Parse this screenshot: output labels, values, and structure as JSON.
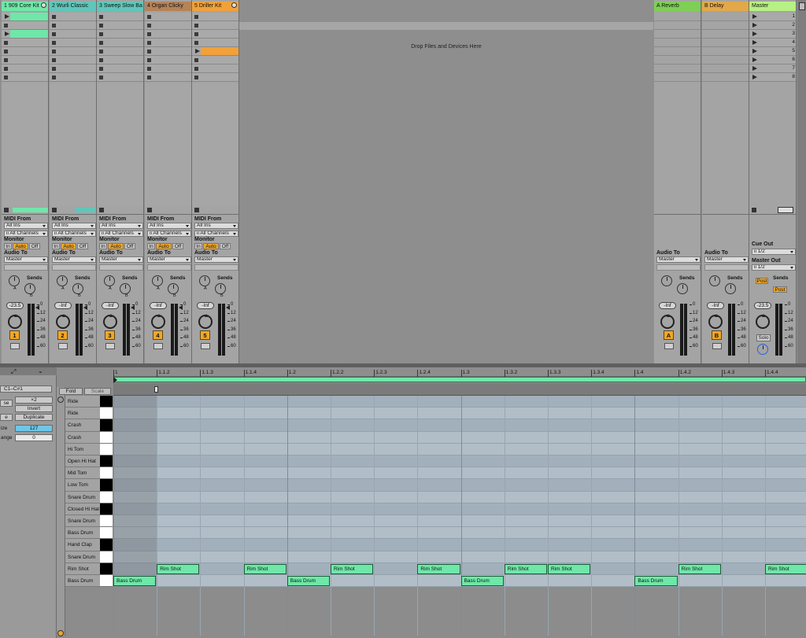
{
  "tracks": [
    {
      "name": "1 909 Core Kit",
      "color": "#6fe7a8",
      "number": "1",
      "volume": "-23.5"
    },
    {
      "name": "2 Wurli Classic",
      "color": "#5fc7ba",
      "number": "2",
      "volume": "-Inf"
    },
    {
      "name": "3 Sweep Slow Ba",
      "color": "#5fc7ba",
      "number": "3",
      "volume": "-Inf"
    },
    {
      "name": "4 Organ Clicky",
      "color": "#b58358",
      "number": "4",
      "volume": "-Inf"
    },
    {
      "name": "5 Driller Kit",
      "color": "#f0a13a",
      "number": "5",
      "volume": "-Inf"
    }
  ],
  "returns": [
    {
      "name": "A Reverb",
      "color": "#7ecf54",
      "letter": "A",
      "volume": "-Inf"
    },
    {
      "name": "B Delay",
      "color": "#e2a84a",
      "letter": "B",
      "volume": "-Inf"
    }
  ],
  "master": {
    "name": "Master",
    "color": "#b7f084",
    "volume": "-23.5",
    "scenes": [
      "1",
      "2",
      "3",
      "4",
      "5",
      "6",
      "7",
      "8"
    ],
    "cue_out_label": "Cue Out",
    "cue_out": "ii 1/2",
    "master_out_label": "Master Out",
    "master_out": "ii 1/2",
    "post1": "Post",
    "post2": "Post",
    "solo": "Solo"
  },
  "drop_hint": "Drop Files and Devices Here",
  "io": {
    "midi_from": "MIDI From",
    "all_ins": "All Ins",
    "all_channels": "ii All Channels",
    "monitor": "Monitor",
    "in": "In",
    "auto": "Auto",
    "off": "Off",
    "audio_to": "Audio To",
    "master": "Master",
    "sends": "Sends",
    "send_a": "A",
    "send_b": "B"
  },
  "meter_ticks": [
    "0",
    "12",
    "24",
    "36",
    "48",
    "60"
  ],
  "clip_editor": {
    "range": "C1–C#1",
    "x2": "×2",
    "invert_prefix": "se",
    "invert": "Invert",
    "duplicate_prefix": "e",
    "duplicate": "Duplicate",
    "size_label": "ize",
    "size_value": "127",
    "range_label": "ange",
    "range_value": "0",
    "fold": "Fold",
    "scale": "Scale",
    "ruler": [
      "1",
      "1.1.2",
      "1.1.3",
      "1.1.4",
      "1.2",
      "1.2.2",
      "1.2.3",
      "1.2.4",
      "1.3",
      "1.3.2",
      "1.3.3",
      "1.3.4",
      "1.4",
      "1.4.2",
      "1.4.3",
      "1.4.4"
    ],
    "rows": [
      "Ride",
      "Ride",
      "Crash",
      "Crash",
      "Hi Tom",
      "Open Hi Hat",
      "Mid Tom",
      "Low Tom",
      "Snare Drum",
      "Closed Hi Hat",
      "Snare Drum",
      "Bass Drum",
      "Hand Clap",
      "Snare Drum",
      "Rim Shot",
      "Bass Drum"
    ],
    "notes": [
      {
        "row": 15,
        "step": 0,
        "label": "Bass Drum"
      },
      {
        "row": 14,
        "step": 1,
        "label": "Rim Shot"
      },
      {
        "row": 14,
        "step": 3,
        "label": "Rim Shot"
      },
      {
        "row": 15,
        "step": 4,
        "label": "Bass Drum"
      },
      {
        "row": 14,
        "step": 5,
        "label": "Rim Shot"
      },
      {
        "row": 14,
        "step": 7,
        "label": "Rim Shot"
      },
      {
        "row": 15,
        "step": 8,
        "label": "Bass Drum"
      },
      {
        "row": 14,
        "step": 9,
        "label": "Rim Shot"
      },
      {
        "row": 14,
        "step": 10,
        "label": "Rim Shot"
      },
      {
        "row": 15,
        "step": 12,
        "label": "Bass Drum"
      },
      {
        "row": 14,
        "step": 13,
        "label": "Rim Shot"
      },
      {
        "row": 14,
        "step": 15,
        "label": "Rim Shot"
      }
    ]
  }
}
